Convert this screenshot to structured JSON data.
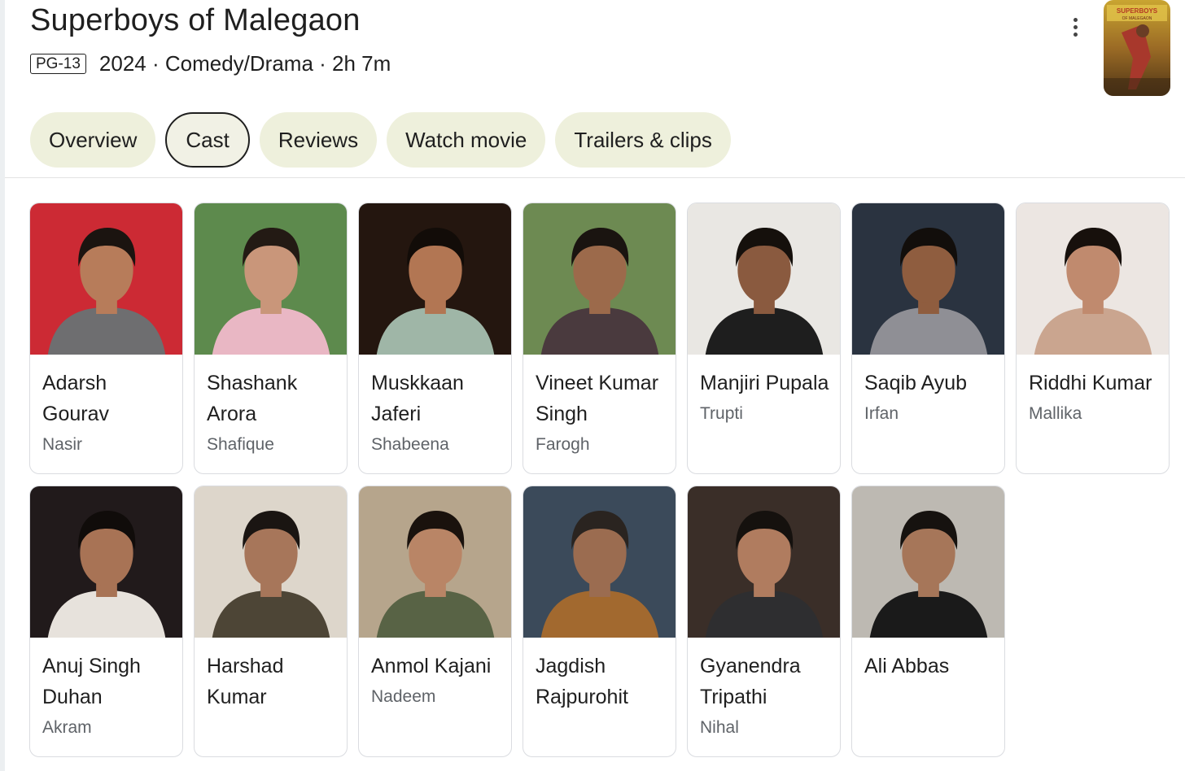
{
  "movie": {
    "title": "Superboys of Malegaon",
    "rating": "PG-13",
    "info": "2024 · Comedy/Drama · 2h 7m",
    "poster_text": "SUPERBOYS OF MALEGAON"
  },
  "tabs": [
    {
      "label": "Overview",
      "active": false
    },
    {
      "label": "Cast",
      "active": true
    },
    {
      "label": "Reviews",
      "active": false
    },
    {
      "label": "Watch movie",
      "active": false
    },
    {
      "label": "Trailers & clips",
      "active": false
    }
  ],
  "cast": [
    {
      "actor": "Adarsh Gourav",
      "role": "Nasir",
      "bg": "#cc2a34",
      "skin": "#b77c5a",
      "hair": "#1b1410",
      "shirt": "#6e6e70"
    },
    {
      "actor": "Shashank Arora",
      "role": "Shafique",
      "bg": "#5d8a4d",
      "skin": "#c9967a",
      "hair": "#231a14",
      "shirt": "#e9b7c4"
    },
    {
      "actor": "Muskkaan Jaferi",
      "role": "Shabeena",
      "bg": "#24160f",
      "skin": "#b27653",
      "hair": "#120c08",
      "shirt": "#9fb6a7"
    },
    {
      "actor": "Vineet Kumar Singh",
      "role": "Farogh",
      "bg": "#6d8a52",
      "skin": "#9c6a4b",
      "hair": "#1a1410",
      "shirt": "#4a3a3e"
    },
    {
      "actor": "Manjiri Pupala",
      "role": "Trupti",
      "bg": "#e9e7e3",
      "skin": "#8a5a3f",
      "hair": "#15100c",
      "shirt": "#1e1e1e"
    },
    {
      "actor": "Saqib Ayub",
      "role": "Irfan",
      "bg": "#2a3340",
      "skin": "#8f5d3f",
      "hair": "#120e0b",
      "shirt": "#8f8f95"
    },
    {
      "actor": "Riddhi Kumar",
      "role": "Mallika",
      "bg": "#ece6e2",
      "skin": "#c08a6e",
      "hair": "#17100c",
      "shirt": "#caa58f"
    },
    {
      "actor": "Anuj Singh Duhan",
      "role": "Akram",
      "bg": "#211a1b",
      "skin": "#a87355",
      "hair": "#100c0a",
      "shirt": "#e7e2dc"
    },
    {
      "actor": "Harshad Kumar",
      "role": "",
      "bg": "#ddd6cb",
      "skin": "#a7765a",
      "hair": "#1a1512",
      "shirt": "#4d4536"
    },
    {
      "actor": "Anmol Kajani",
      "role": "Nadeem",
      "bg": "#b6a58c",
      "skin": "#b98566",
      "hair": "#1a120d",
      "shirt": "#586345"
    },
    {
      "actor": "Jagdish Rajpurohit",
      "role": "",
      "bg": "#3b4a5a",
      "skin": "#9b6c50",
      "hair": "#2a2420",
      "shirt": "#a2692f"
    },
    {
      "actor": "Gyanendra Tripathi",
      "role": "Nihal",
      "bg": "#3a2e28",
      "skin": "#b07c5f",
      "hair": "#15110e",
      "shirt": "#2e2e30"
    },
    {
      "actor": "Ali Abbas",
      "role": "",
      "bg": "#bdb9b2",
      "skin": "#a67659",
      "hair": "#16120f",
      "shirt": "#1a1a1a"
    }
  ]
}
